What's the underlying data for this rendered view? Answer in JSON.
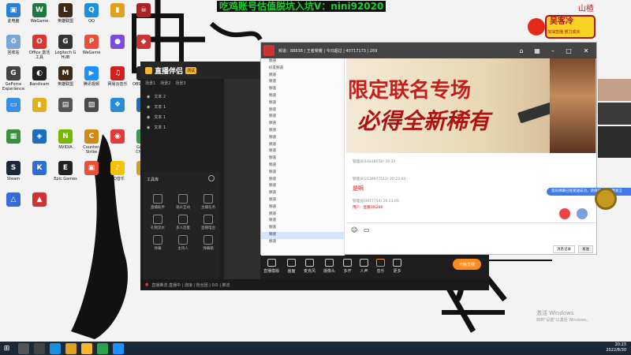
{
  "banner": {
    "text": "吃鸡账号估值脱坑入坑V：nini92020"
  },
  "right_top": {
    "name": "山楂",
    "logo_text": "吴客冷",
    "logo_sub": "加油直播 努力成长"
  },
  "desktop": {
    "icons": [
      {
        "label": "此电脑",
        "color": "#2d7fd6",
        "glyph": "▣"
      },
      {
        "label": "WeGame",
        "color": "#1c7a3c",
        "glyph": "W"
      },
      {
        "label": "英雄联盟",
        "color": "#3c2c16",
        "glyph": "L"
      },
      {
        "label": "QQ",
        "color": "#1a8fe0",
        "glyph": "Q"
      },
      {
        "label": "",
        "color": "#e0a020",
        "glyph": "▮"
      },
      {
        "label": "",
        "color": "#a22",
        "glyph": "☠"
      },
      {
        "label": "回收站",
        "color": "#7aa7d6",
        "glyph": "♻"
      },
      {
        "label": "Office 激活工具",
        "color": "#d33",
        "glyph": "O"
      },
      {
        "label": "Logitech G HUB",
        "color": "#333",
        "glyph": "G"
      },
      {
        "label": "WeGame",
        "color": "#e8503a",
        "glyph": "P"
      },
      {
        "label": "",
        "color": "#7a4ce0",
        "glyph": "●"
      },
      {
        "label": "",
        "color": "#c33",
        "glyph": "◆"
      },
      {
        "label": "GeForce Experience",
        "color": "#444",
        "glyph": "G"
      },
      {
        "label": "Bandicam",
        "color": "#222",
        "glyph": "◐"
      },
      {
        "label": "英雄联盟",
        "color": "#3c2c16",
        "glyph": "M"
      },
      {
        "label": "腾讯视频",
        "color": "#1e90ff",
        "glyph": "▶"
      },
      {
        "label": "网易云音乐",
        "color": "#d02020",
        "glyph": "♫"
      },
      {
        "label": "OBS Studio",
        "color": "#222",
        "glyph": "◎"
      },
      {
        "label": "",
        "color": "#3a8ee6",
        "glyph": "▭"
      },
      {
        "label": "",
        "color": "#e0b020",
        "glyph": "▮"
      },
      {
        "label": "",
        "color": "#555",
        "glyph": "▤"
      },
      {
        "label": "",
        "color": "#4a4a4a",
        "glyph": "▨"
      },
      {
        "label": "",
        "color": "#2a8bd6",
        "glyph": "❖"
      },
      {
        "label": "",
        "color": "#1a6ebd",
        "glyph": "⬢"
      },
      {
        "label": "",
        "color": "#3d8f3d",
        "glyph": "▦"
      },
      {
        "label": "",
        "color": "#1a6ebd",
        "glyph": "◈"
      },
      {
        "label": "NVIDIA",
        "color": "#76b900",
        "glyph": "N"
      },
      {
        "label": "Counter-Strike",
        "color": "#d08a1a",
        "glyph": "C"
      },
      {
        "label": "",
        "color": "#e03a3a",
        "glyph": "◉"
      },
      {
        "label": "Google Chrome",
        "color": "#2ba24c",
        "glyph": "●"
      },
      {
        "label": "Steam",
        "color": "#1b2838",
        "glyph": "S"
      },
      {
        "label": "",
        "color": "#2a6ed6",
        "glyph": "K"
      },
      {
        "label": "Epic Games",
        "color": "#222",
        "glyph": "E"
      },
      {
        "label": "",
        "color": "#e8503a",
        "glyph": "▣"
      },
      {
        "label": "QQ音乐",
        "color": "#f5c400",
        "glyph": "♪"
      },
      {
        "label": "",
        "color": "#d4a020",
        "glyph": "◢"
      },
      {
        "label": "",
        "color": "#3a6ad6",
        "glyph": "△"
      },
      {
        "label": "",
        "color": "#c33",
        "glyph": "▲"
      }
    ]
  },
  "app": {
    "logo": "直播伴侣",
    "logo_badge": "测试",
    "scene_tabs": [
      "场景1",
      "场景2",
      "场景3"
    ],
    "scenes": [
      "文本 2",
      "文本 1",
      "文本 1",
      "文本 1"
    ],
    "tools_title": "工具库",
    "tools": [
      "直播助手",
      "观众互动",
      "主播任务",
      "礼物流水",
      "多人连麦",
      "直播电台",
      "弹幕",
      "主持人",
      "弹幕箱"
    ],
    "bottom": [
      "直播模版",
      "画面",
      "麦克风",
      "摄像头",
      "多开",
      "人声",
      "音乐",
      "更多"
    ],
    "live_btn": "开始直播",
    "status": "直播推流 直播中 | 连接 | 粉丝团 | 0/0 | 推流"
  },
  "yy": {
    "title": "频道：88838 | 王者荣耀 | 今日超过 | 40717173 | 269",
    "list": [
      "频道",
      "好友频道",
      "频道",
      "频道",
      "频道",
      "频道",
      "频道",
      "频道",
      "频道",
      "频道",
      "频道",
      "频道",
      "频道",
      "频道",
      "频道",
      "频道",
      "频道",
      "频道",
      "频道",
      "频道",
      "频道",
      "频道",
      "频道",
      "频道",
      "频道",
      "频道",
      "频道"
    ],
    "ad_line1": "限定联名专场",
    "ad_line2": "必得全新稀有",
    "chat": [
      {
        "text": "管理员(16818058) 20:23:"
      },
      {
        "text": "管理员(2138977512) 20:23:04:"
      },
      {
        "text": "是啊"
      },
      {
        "text": "管理员(3977754)  20:23:05:"
      },
      {
        "text": "用户：直播间6280"
      }
    ],
    "bubble": "您的弹幕已经发送成功，请保持礼貌文明发言",
    "bar": [
      "消息记录",
      "发送"
    ]
  },
  "taskbar": {
    "time": "20:23",
    "date": "2022/8/30"
  },
  "activate": {
    "line1": "激活 Windows",
    "line2": "转到\"设置\"以激活 Windows。"
  }
}
